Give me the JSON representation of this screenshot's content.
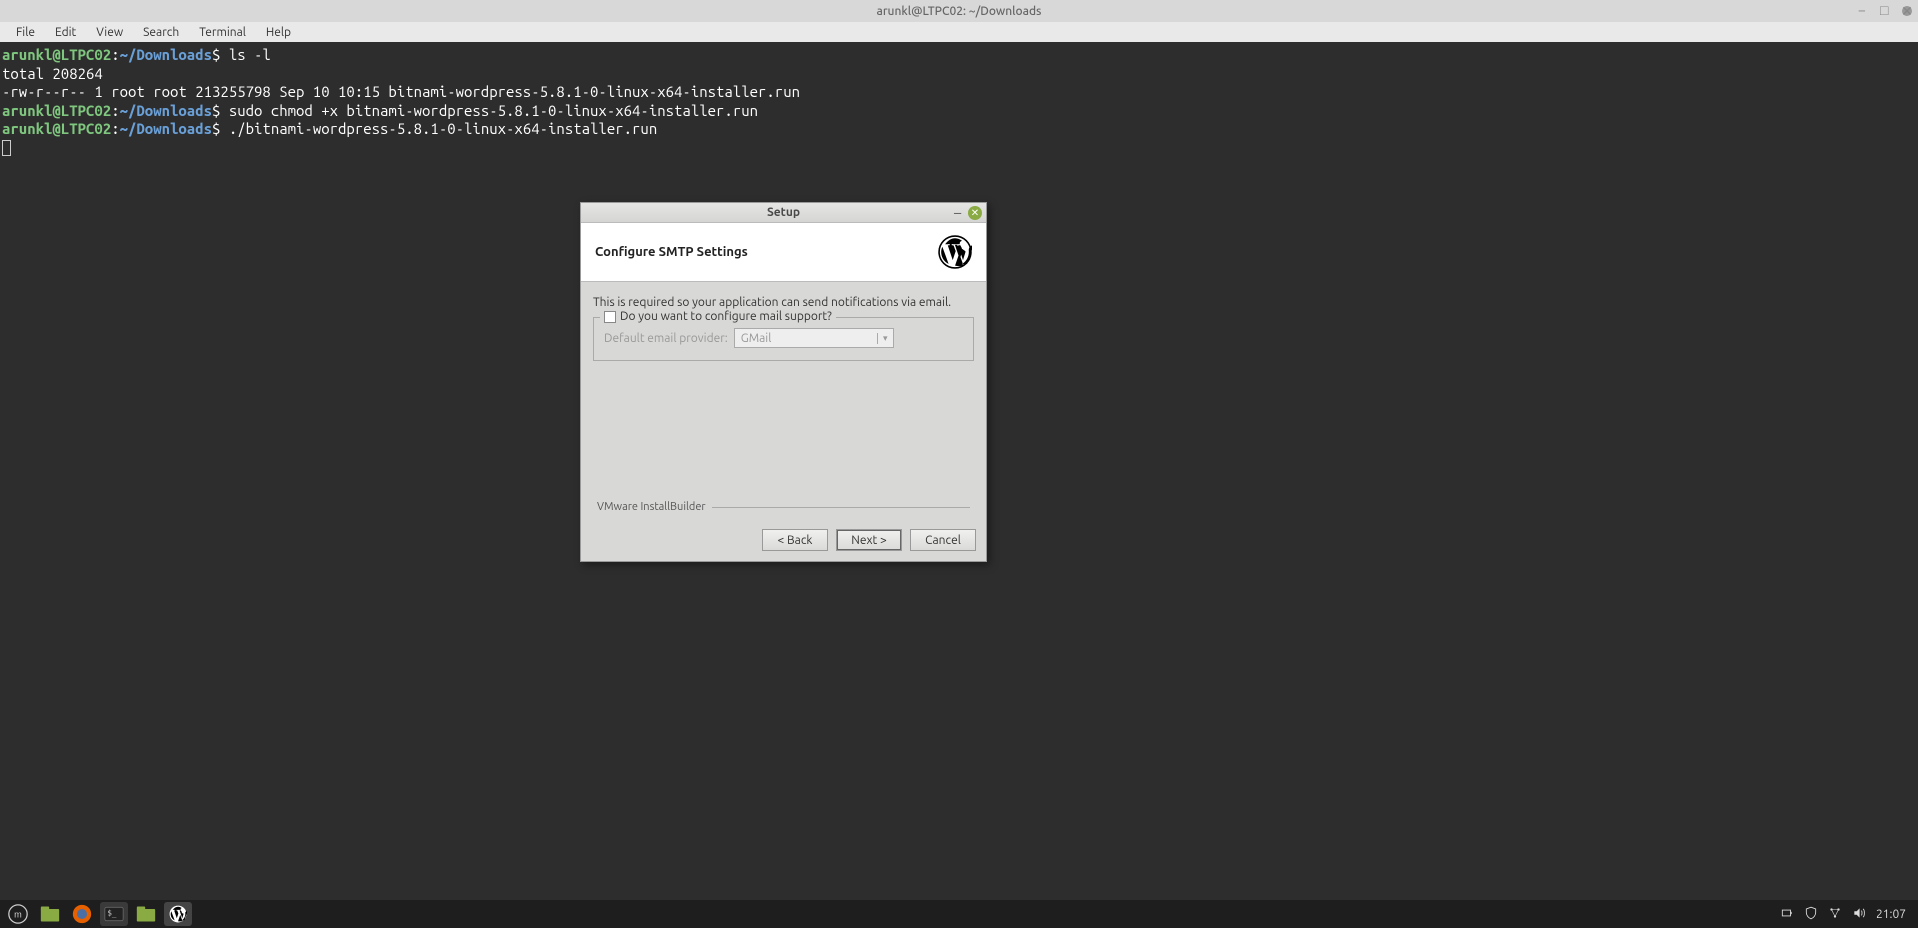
{
  "window": {
    "title": "arunkl@LTPC02: ~/Downloads"
  },
  "menubar": {
    "items": [
      "File",
      "Edit",
      "View",
      "Search",
      "Terminal",
      "Help"
    ]
  },
  "terminal": {
    "lines": [
      {
        "user": "arunkl@LTPC02",
        "path": "~/Downloads",
        "sep": ":",
        "cmd": "ls -l"
      },
      {
        "out": "total 208264"
      },
      {
        "out": "-rw-r--r-- 1 root root 213255798 Sep 10 10:15 bitnami-wordpress-5.8.1-0-linux-x64-installer.run"
      },
      {
        "user": "arunkl@LTPC02",
        "path": "~/Downloads",
        "sep": ":",
        "cmd": "sudo chmod +x bitnami-wordpress-5.8.1-0-linux-x64-installer.run"
      },
      {
        "user": "arunkl@LTPC02",
        "path": "~/Downloads",
        "sep": ":",
        "cmd": "./bitnami-wordpress-5.8.1-0-linux-x64-installer.run"
      }
    ]
  },
  "dialog": {
    "title": "Setup",
    "header": "Configure SMTP Settings",
    "body_text": "This is required so your application can send notifications via email.",
    "checkbox_label": "Do you want to configure mail support?",
    "provider_label": "Default email provider:",
    "provider_value": "GMail",
    "footer_label": "VMware InstallBuilder",
    "buttons": {
      "back": "< Back",
      "next": "Next >",
      "cancel": "Cancel"
    }
  },
  "taskbar": {
    "clock": "21:07"
  }
}
